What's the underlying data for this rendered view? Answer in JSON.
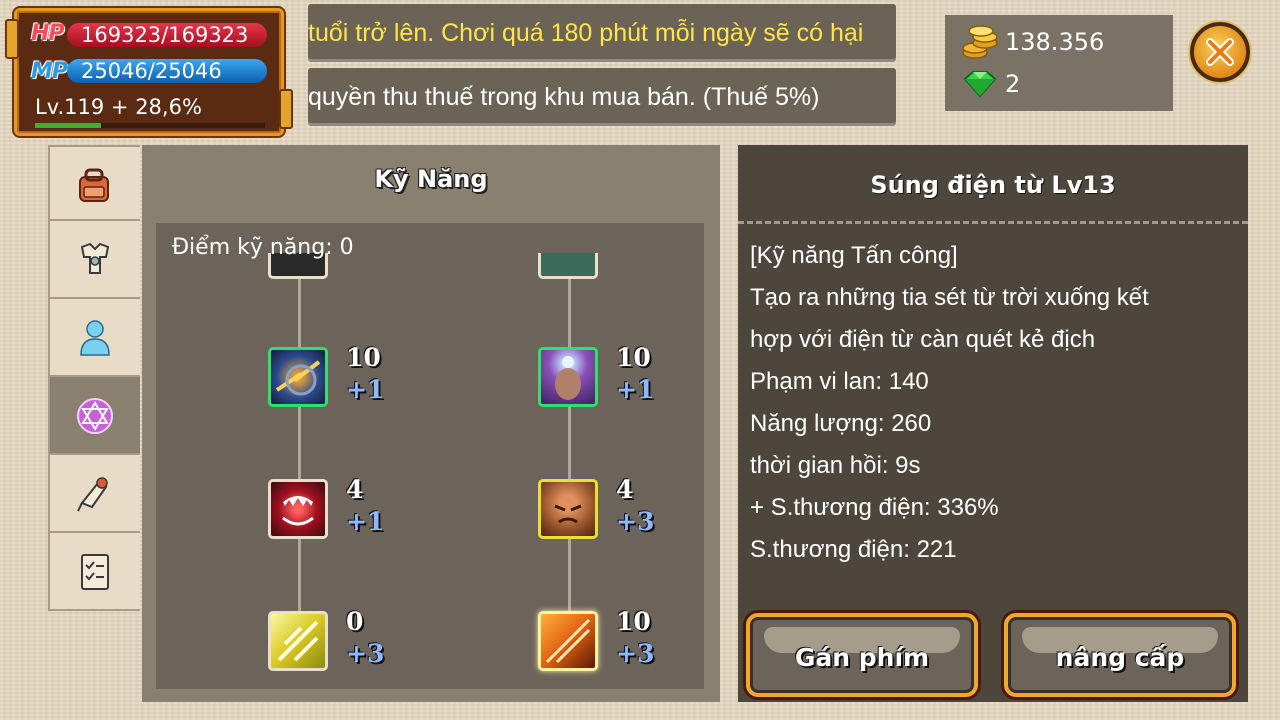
{
  "player": {
    "hp_label": "HP",
    "hp_value": "169323/169323",
    "mp_label": "MP",
    "mp_value": "25046/25046",
    "level": "Lv.119 + 28,6%",
    "exp_fraction": 0.286
  },
  "banners": {
    "line1": "tuổi trở lên. Chơi quá 180 phút mỗi ngày sẽ có hại",
    "line2": "quyền thu thuế trong khu mua bán. (Thuế 5%)"
  },
  "currency": {
    "gold": "138.356",
    "gems": "2"
  },
  "tabs": [
    {
      "name": "bag-icon"
    },
    {
      "name": "armor-icon"
    },
    {
      "name": "character-icon"
    },
    {
      "name": "skill-pentagram-icon"
    },
    {
      "name": "quest-scroll-icon"
    },
    {
      "name": "task-list-icon"
    }
  ],
  "skill_panel": {
    "title": "Kỹ Năng",
    "points_label": "Điểm kỹ năng: 0",
    "skills": [
      {
        "level": "10",
        "plus": "+1",
        "border": "#2fe06a",
        "icon": "lightning-vortex-icon"
      },
      {
        "level": "10",
        "plus": "+1",
        "border": "#2fe06a",
        "icon": "mind-glow-icon"
      },
      {
        "level": "4",
        "plus": "+1",
        "border": "#e8e0c8",
        "icon": "fang-bite-icon"
      },
      {
        "level": "4",
        "plus": "+3",
        "border": "#e8e030",
        "icon": "rage-face-icon"
      },
      {
        "level": "0",
        "plus": "+3",
        "border": "#e8e0c8",
        "icon": "yellow-spark-icon"
      },
      {
        "level": "10",
        "plus": "+3",
        "border": "#fff2a0",
        "icon": "orange-slash-icon"
      }
    ]
  },
  "detail": {
    "title": "Súng điện từ Lv13",
    "lines": [
      "[Kỹ năng Tấn công]",
      "Tạo ra những tia sét từ trời xuống kết",
      "hợp với điện từ càn quét kẻ địch",
      "Phạm vi lan: 140",
      "Năng lượng: 260",
      "thời gian hồi: 9s",
      "+ S.thương điện: 336%",
      "S.thương điện: 221"
    ],
    "assign_button": "Gán phím",
    "upgrade_button": "nâng cấp"
  }
}
